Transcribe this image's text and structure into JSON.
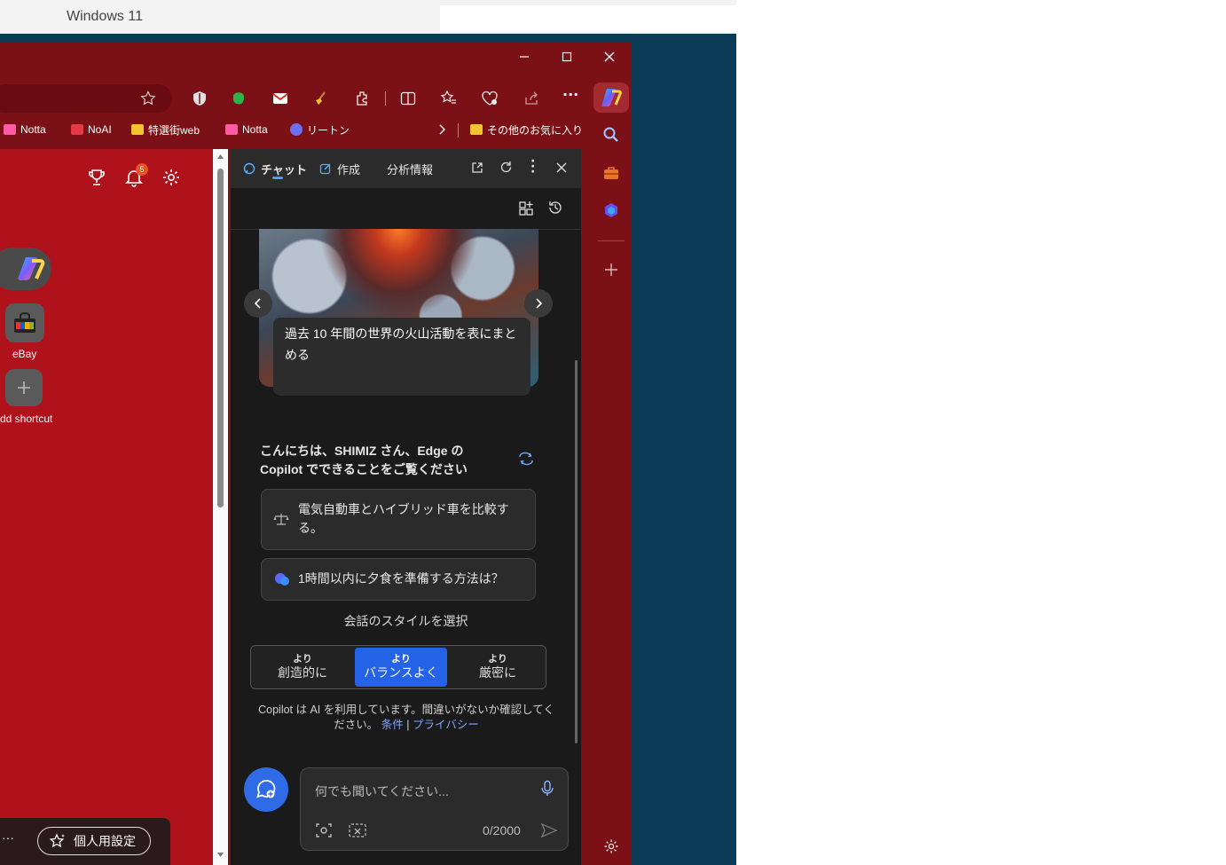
{
  "window": {
    "title": "Windows 11"
  },
  "bookmarks": [
    {
      "label": "Notta",
      "color": "#ff5aa5"
    },
    {
      "label": "NoAI",
      "color": "#e63946"
    },
    {
      "label": "特選街web",
      "color": "#f4c430"
    },
    {
      "label": "Notta",
      "color": "#ff5aa5"
    },
    {
      "label": "リートン",
      "color": "#6e6ef0"
    }
  ],
  "bookmarks_other": "その他のお気に入り",
  "newtab": {
    "shortcuts": [
      {
        "label": "eBay"
      },
      {
        "label": "dd shortcut"
      }
    ],
    "notification_count": "5",
    "personal_settings": "個人用設定",
    "more": "···"
  },
  "copilot": {
    "tabs": {
      "chat": "チャット",
      "compose": "作成",
      "insights": "分析情報"
    },
    "carousel_prompt": "過去 10 年間の世界の火山活動を表にまとめる",
    "greeting": "こんにちは、SHIMIZ さん、Edge の Copilot でできることをご覧ください",
    "suggestions": [
      "電気自動車とハイブリッド車を比較する。",
      "1時間以内に夕食を準備する方法は？"
    ],
    "style_label": "会話のスタイルを選択",
    "styles": [
      {
        "small": "より",
        "main": "創造的に"
      },
      {
        "small": "より",
        "main": "バランスよく"
      },
      {
        "small": "より",
        "main": "厳密に"
      }
    ],
    "disclaimer": "Copilot は AI を利用しています。間違いがないか確認してください。",
    "terms": "条件",
    "sep": "|",
    "privacy": "プライバシー",
    "input_placeholder": "何でも聞いてください...",
    "counter": "0/2000"
  },
  "colors": {
    "browser_frame": "#7b1016",
    "newtab_bg": "#b0121c",
    "accent_blue": "#2f6be6",
    "pane_bg": "#1a1a1a"
  }
}
